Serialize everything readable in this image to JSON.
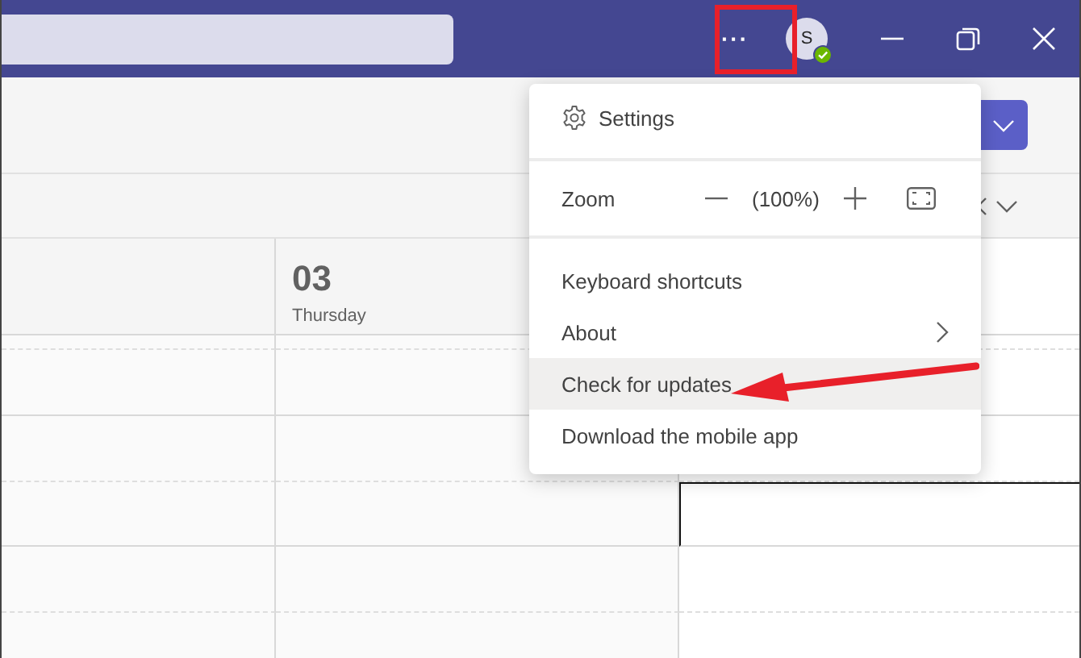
{
  "title_bar": {
    "more_label": "···",
    "avatar": {
      "initial": "S"
    }
  },
  "calendar": {
    "day": {
      "date": "03",
      "weekday": "Thursday"
    },
    "selected_slot": true
  },
  "menu": {
    "items": [
      {
        "kind": "settings",
        "label": "Settings",
        "selected": false
      },
      {
        "kind": "divider"
      },
      {
        "kind": "zoom",
        "label": "Zoom",
        "value": "(100%)"
      },
      {
        "kind": "divider"
      },
      {
        "kind": "item",
        "label": "Keyboard shortcuts",
        "selected": false
      },
      {
        "kind": "item",
        "label": "About",
        "submenu": true,
        "selected": false
      },
      {
        "kind": "item",
        "label": "Check for updates",
        "selected": true
      },
      {
        "kind": "item",
        "label": "Download the mobile app",
        "selected": false
      }
    ]
  }
}
